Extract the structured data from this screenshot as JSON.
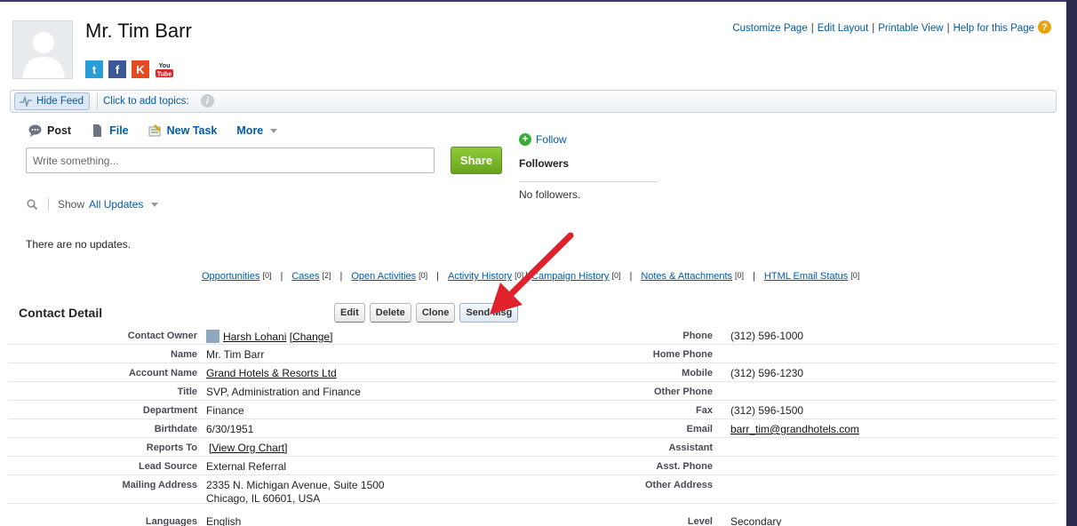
{
  "contact": {
    "name": "Mr. Tim Barr"
  },
  "social": [
    {
      "icon": "twitter-icon",
      "glyph": "t"
    },
    {
      "icon": "facebook-icon",
      "glyph": "f"
    },
    {
      "icon": "klout-icon",
      "glyph": "K"
    },
    {
      "icon": "youtube-icon",
      "glyph": "You Tube"
    }
  ],
  "top_links": {
    "customize": "Customize Page",
    "edit_layout": "Edit Layout",
    "printable": "Printable View",
    "help": "Help for this Page",
    "sep": "|"
  },
  "feed_bar": {
    "hide_feed": "Hide Feed",
    "add_topics": "Click to add topics:"
  },
  "publisher": {
    "tabs": {
      "post": "Post",
      "file": "File",
      "new_task": "New Task",
      "more": "More"
    },
    "placeholder": "Write something...",
    "share": "Share"
  },
  "followers": {
    "follow": "Follow",
    "heading": "Followers",
    "empty": "No followers."
  },
  "filter": {
    "show": "Show",
    "value": "All Updates"
  },
  "feed_empty": "There are no updates.",
  "related_lists": [
    {
      "label": "Opportunities",
      "count": "[0]"
    },
    {
      "label": "Cases",
      "count": "[2]"
    },
    {
      "label": "Open Activities",
      "count": "[0]"
    },
    {
      "label": "Activity History",
      "count": "[0]"
    },
    {
      "label": "Campaign History",
      "count": "[0]"
    },
    {
      "label": "Notes & Attachments",
      "count": "[0]"
    },
    {
      "label": "HTML Email Status",
      "count": "[0]"
    }
  ],
  "contact_detail": {
    "title": "Contact Detail",
    "buttons": {
      "edit": "Edit",
      "delete": "Delete",
      "clone": "Clone",
      "send_msg": "Send Msg"
    },
    "left": {
      "contact_owner_label": "Contact Owner",
      "contact_owner_value": "Harsh Lohani",
      "contact_owner_change": "[Change]",
      "name_label": "Name",
      "name_value": "Mr. Tim Barr",
      "account_label": "Account Name",
      "account_value": "Grand Hotels & Resorts Ltd",
      "title_label": "Title",
      "title_value": "SVP, Administration and Finance",
      "department_label": "Department",
      "department_value": "Finance",
      "birthdate_label": "Birthdate",
      "birthdate_value": "6/30/1951",
      "reports_label": "Reports To",
      "reports_value": "[View Org Chart]",
      "lead_label": "Lead Source",
      "lead_value": "External Referral",
      "mailing_label": "Mailing Address",
      "mailing_line1": "2335 N. Michigan Avenue, Suite 1500",
      "mailing_line2": "Chicago, IL 60601, USA",
      "languages_label": "Languages",
      "languages_value": "English"
    },
    "right": {
      "phone_label": "Phone",
      "phone_value": "(312) 596-1000",
      "home_phone_label": "Home Phone",
      "mobile_label": "Mobile",
      "mobile_value": "(312) 596-1230",
      "other_phone_label": "Other Phone",
      "fax_label": "Fax",
      "fax_value": "(312) 596-1500",
      "email_label": "Email",
      "email_value": "barr_tim@grandhotels.com",
      "assistant_label": "Assistant",
      "asst_phone_label": "Asst. Phone",
      "other_address_label": "Other Address",
      "level_label": "Level",
      "level_value": "Secondary"
    }
  },
  "colors": {
    "link": "#015ba7",
    "share": "#6aa41c",
    "arrow": "#e0202a"
  }
}
